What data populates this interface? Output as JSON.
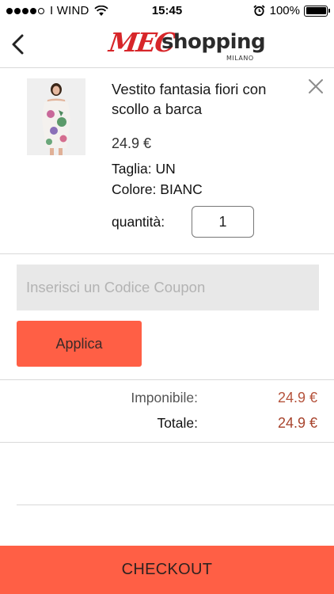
{
  "status_bar": {
    "carrier": "I WIND",
    "time": "15:45",
    "battery": "100%",
    "signal_bars": 4
  },
  "header": {
    "logo": {
      "mec": "MEC",
      "shopping": "shopping",
      "milano": "MILANO"
    },
    "back_icon": "chevron-left-icon"
  },
  "cart": {
    "item": {
      "name": "Vestito fantasia fiori con scollo a barca",
      "price": "24.9 €",
      "size_label": "Taglia:",
      "size_value": "UN",
      "color_label": "Colore:",
      "color_value": "BIANC",
      "quantity_label": "quantità:",
      "quantity_value": "1",
      "remove_icon": "close-icon"
    }
  },
  "coupon": {
    "placeholder": "Inserisci un Codice Coupon",
    "apply_label": "Applica"
  },
  "totals": {
    "subtotal_label": "Imponibile:",
    "subtotal_value": "24.9 €",
    "total_label": "Totale:",
    "total_value": "24.9 €"
  },
  "checkout": {
    "label": "CHECKOUT"
  },
  "colors": {
    "accent": "#ff5f45",
    "price_red": "#b5533c",
    "logo_red": "#d7262a"
  }
}
